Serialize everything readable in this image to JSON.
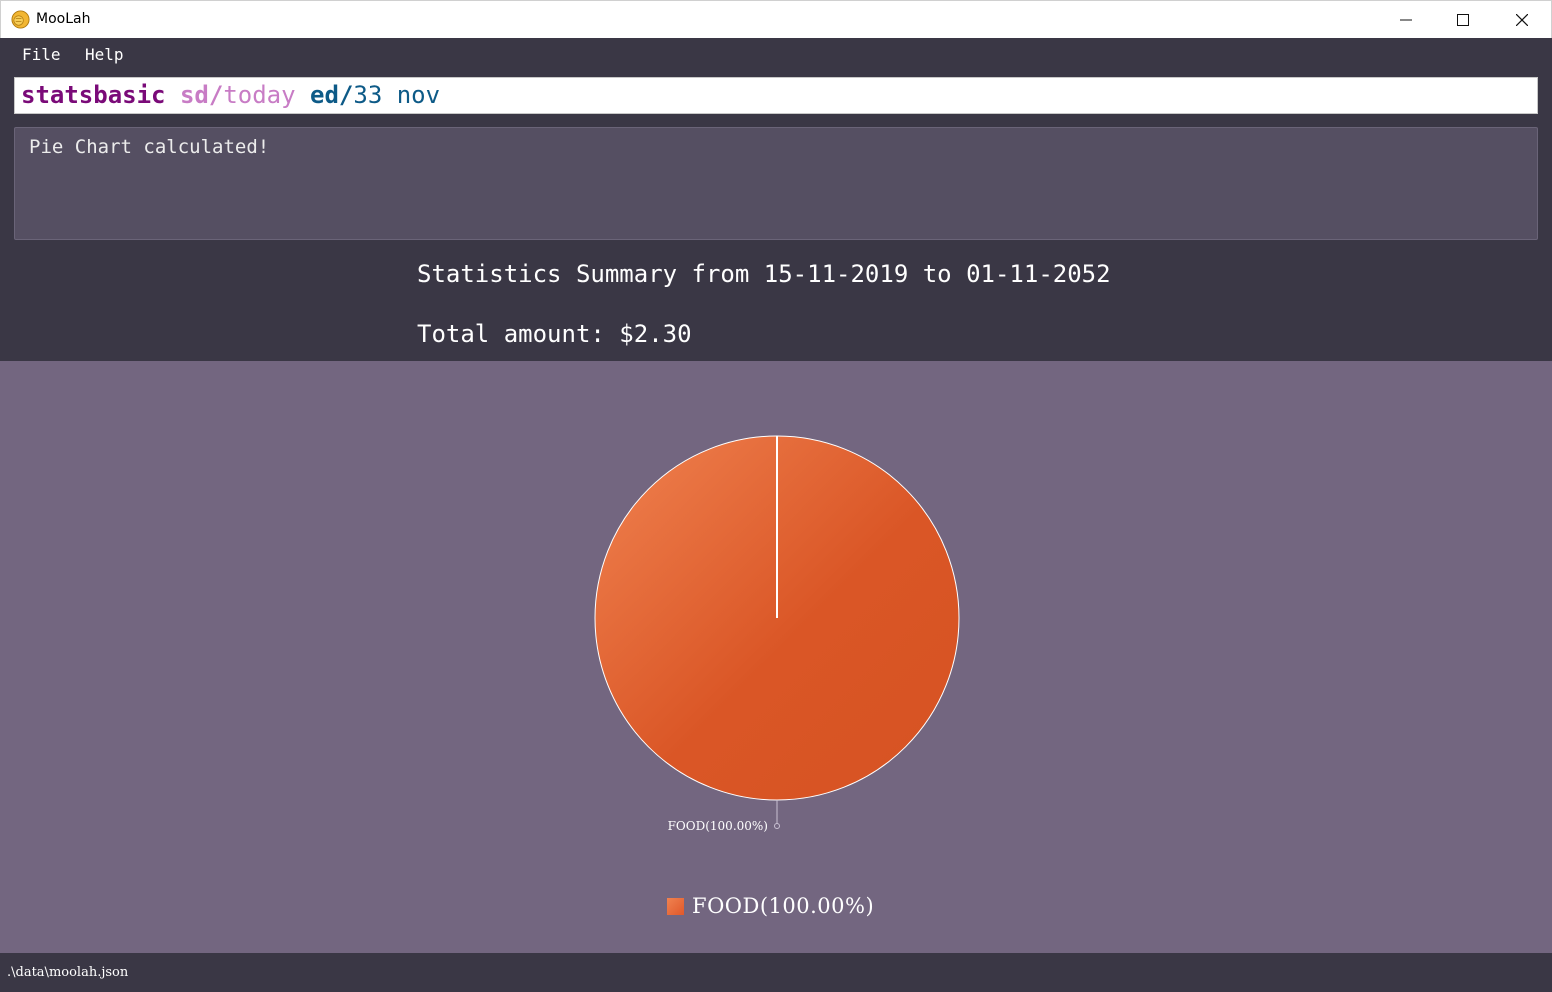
{
  "window": {
    "title": "MooLah",
    "icon": "coin-stack-icon",
    "controls": [
      "minimize-icon",
      "maximize-icon",
      "close-icon"
    ]
  },
  "menu": {
    "file": "File",
    "help": "Help"
  },
  "command": {
    "word": "statsbasic",
    "sd_prefix": "sd/",
    "sd_value": "today",
    "ed_prefix": "ed/",
    "ed_value": "33 nov"
  },
  "result": {
    "message": "Pie Chart calculated!"
  },
  "summary": {
    "title": "Statistics Summary from 15-11-2019 to 01-11-2052",
    "total": "Total amount: $2.30"
  },
  "chart_data": {
    "type": "pie",
    "categories": [
      "FOOD"
    ],
    "values": [
      100.0
    ],
    "slice_labels": [
      "FOOD(100.00%)"
    ],
    "legend": [
      "FOOD(100.00%)"
    ],
    "legend_position": "bottom",
    "colors": [
      "#e0582a"
    ]
  },
  "status": {
    "file_path": ".\\data\\moolah.json"
  },
  "colors": {
    "background": "#3a3745",
    "chart_background": "#736680",
    "result_background": "#554f62",
    "command_word": "#7a0a78",
    "sd_prefix": "#c87cc5",
    "ed_prefix": "#0d5a87",
    "slice": "#e0582a"
  }
}
